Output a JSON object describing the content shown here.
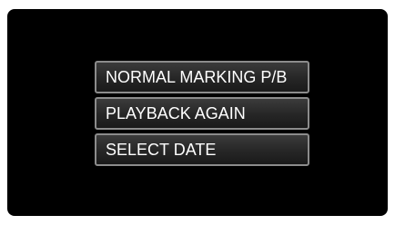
{
  "menu": {
    "items": [
      {
        "label": "NORMAL MARKING P/B"
      },
      {
        "label": "PLAYBACK AGAIN"
      },
      {
        "label": "SELECT DATE"
      }
    ]
  }
}
